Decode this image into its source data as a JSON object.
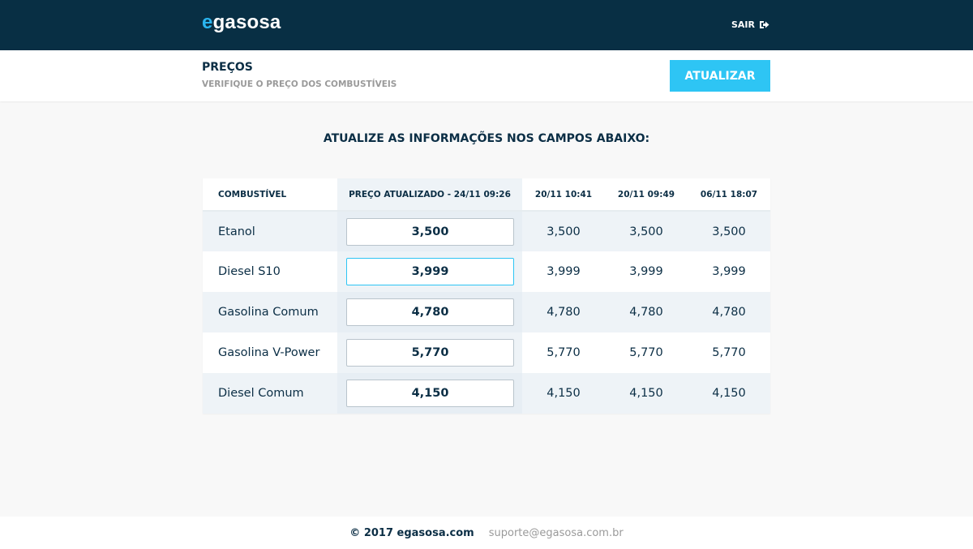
{
  "brand": {
    "prefix": "e",
    "name": "gasosa"
  },
  "header": {
    "logout_label": "SAIR"
  },
  "subheader": {
    "title": "PREÇOS",
    "subtitle": "VERIFIQUE O PREÇO DOS COMBUSTÍVEIS",
    "update_button": "ATUALIZAR"
  },
  "instructions": "ATUALIZE AS INFORMAÇÕES NOS CAMPOS ABAIXO:",
  "table": {
    "headers": {
      "fuel": "COMBUSTÍVEL",
      "current": "PREÇO ATUALIZADO - 24/11 09:26",
      "h1": "20/11 10:41",
      "h2": "20/11 09:49",
      "h3": "06/11 18:07"
    },
    "rows": [
      {
        "fuel": "Etanol",
        "current": "3,500",
        "h1": "3,500",
        "h2": "3,500",
        "h3": "3,500"
      },
      {
        "fuel": "Diesel S10",
        "current": "3,999",
        "h1": "3,999",
        "h2": "3,999",
        "h3": "3,999"
      },
      {
        "fuel": "Gasolina Comum",
        "current": "4,780",
        "h1": "4,780",
        "h2": "4,780",
        "h3": "4,780"
      },
      {
        "fuel": "Gasolina V-Power",
        "current": "5,770",
        "h1": "5,770",
        "h2": "5,770",
        "h3": "5,770"
      },
      {
        "fuel": "Diesel Comum",
        "current": "4,150",
        "h1": "4,150",
        "h2": "4,150",
        "h3": "4,150"
      }
    ]
  },
  "footer": {
    "copyright": "© 2017 egasosa.com",
    "support_email": "suporte@egasosa.com.br"
  },
  "icons": {
    "logout": "sign-out-icon"
  },
  "colors": {
    "topbar": "#082f44",
    "accent": "#2ec5f4",
    "brand_e": "#2ab4ee",
    "text": "#0b2e45"
  }
}
